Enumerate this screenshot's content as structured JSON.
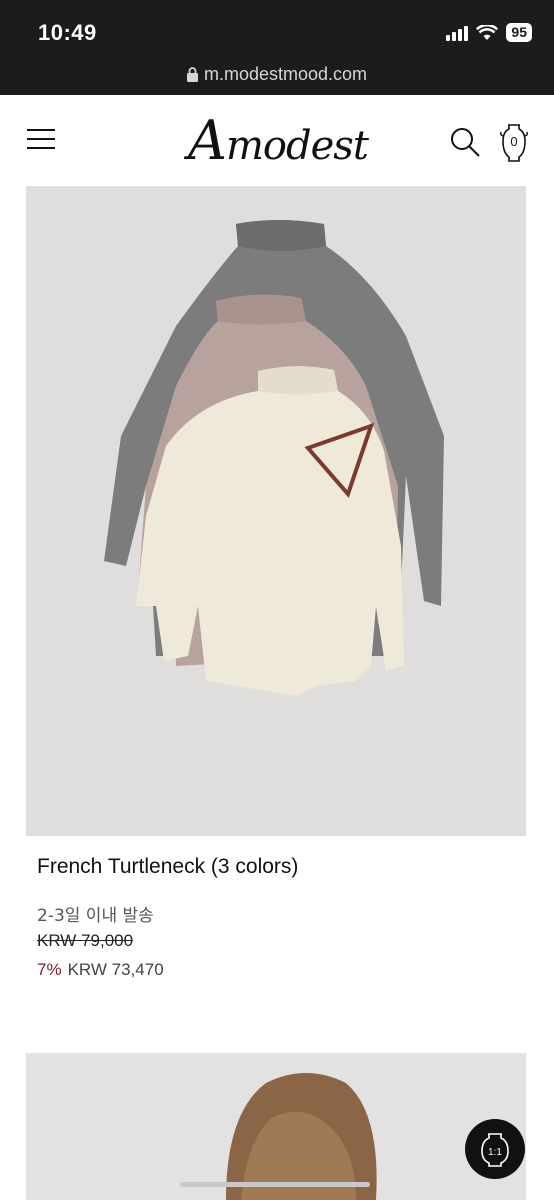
{
  "status": {
    "time": "10:49",
    "battery": "95",
    "url": "m.modestmood.com"
  },
  "header": {
    "logo_initial": "A",
    "logo_rest": "modest",
    "cart_count": "0"
  },
  "product": {
    "title": "French Turtleneck (3 colors)",
    "shipping": "2-3일 이내 발송",
    "original_price": "KRW 79,000",
    "discount": "7%",
    "sale_price": "KRW 73,470",
    "image_alt": "three linen turtlenecks in grey, mauve and cream with sunglasses"
  },
  "fab": {
    "label": "1:1"
  },
  "colors": {
    "status_bar": "#1c1c1e",
    "discount": "#7a1e2c",
    "image_bg": "#dfdedc"
  }
}
